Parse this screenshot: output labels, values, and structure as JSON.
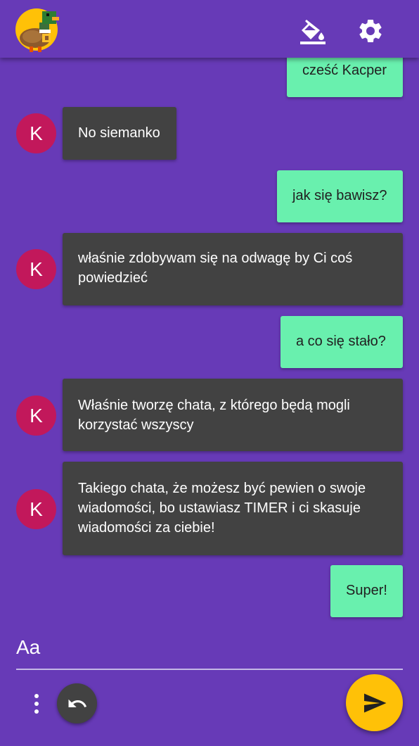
{
  "header": {
    "logo_icon": "duck-logo-icon",
    "theme_icon": "paint-bucket-icon",
    "settings_icon": "gear-icon"
  },
  "messages": [
    {
      "from": "me",
      "text": "cześć Kacper"
    },
    {
      "from": "them",
      "initial": "K",
      "text": "No siemanko"
    },
    {
      "from": "me",
      "text": "jak się bawisz?"
    },
    {
      "from": "them",
      "initial": "K",
      "text": "właśnie zdobywam się na odwagę by Ci coś powiedzieć"
    },
    {
      "from": "me",
      "text": "a co się stało?"
    },
    {
      "from": "them",
      "initial": "K",
      "text": "Właśnie tworzę chata, z którego będą mogli korzystać wszyscy"
    },
    {
      "from": "them",
      "initial": "K",
      "text": "Takiego chata, że możesz być pewien o swoje wiadomości, bo ustawiasz TIMER i ci skasuje wiadomości za ciebie!"
    },
    {
      "from": "me",
      "text": "Super!"
    }
  ],
  "composer": {
    "placeholder": "Aa",
    "more_icon": "more-vert-icon",
    "undo_icon": "undo-icon",
    "send_icon": "send-icon"
  },
  "colors": {
    "background": "#673ab7",
    "my_bubble": "#69f0ae",
    "their_bubble": "#424242",
    "avatar": "#c2185b",
    "accent": "#ffc107"
  }
}
